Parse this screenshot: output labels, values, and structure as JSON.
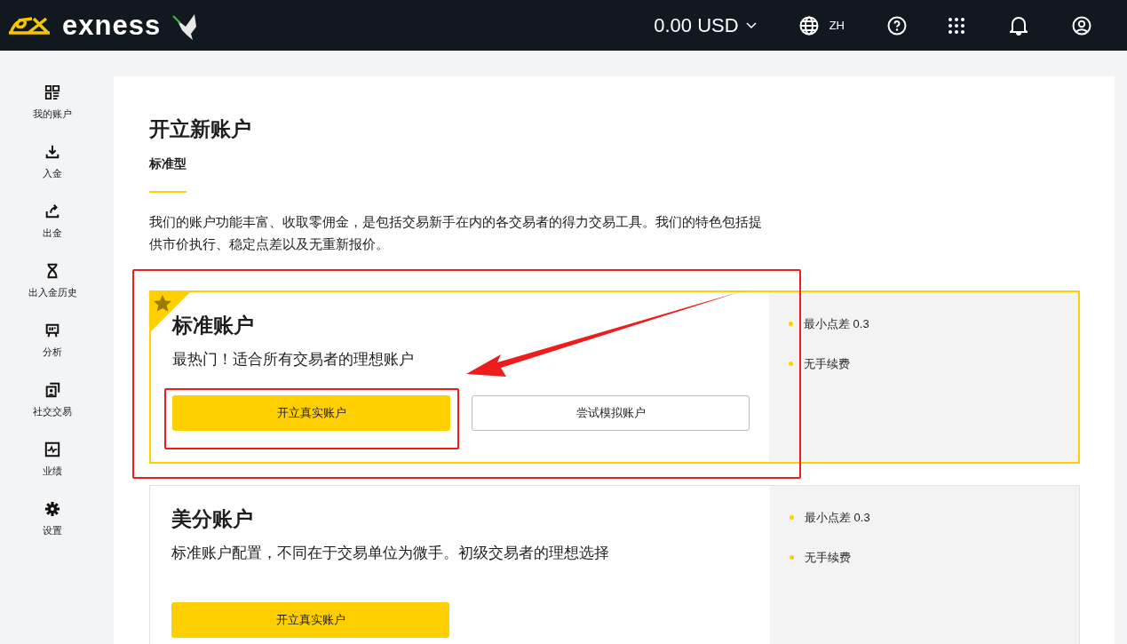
{
  "header": {
    "brand": "exness",
    "balance": "0.00 USD",
    "language": "ZH"
  },
  "sidebar": {
    "items": [
      {
        "label": "我的账户"
      },
      {
        "label": "入金"
      },
      {
        "label": "出金"
      },
      {
        "label": "出入金历史"
      },
      {
        "label": "分析"
      },
      {
        "label": "社交交易"
      },
      {
        "label": "业绩"
      },
      {
        "label": "设置"
      }
    ]
  },
  "page": {
    "title": "开立新账户",
    "tabs": [
      {
        "label": "标准型",
        "selected": true
      }
    ],
    "description": "我们的账户功能丰富、收取零佣金，是包括交易新手在内的各交易者的得力交易工具。我们的特色包括提供市价执行、稳定点差以及无重新报价。"
  },
  "accounts": [
    {
      "name": "标准账户",
      "featured": true,
      "tagline": "最热门！适合所有交易者的理想账户",
      "buttons": [
        {
          "label": "开立真实账户",
          "kind": "primary"
        },
        {
          "label": "尝试模拟账户",
          "kind": "secondary"
        }
      ],
      "features": [
        "最小点差 0.3",
        "无手续费"
      ]
    },
    {
      "name": "美分账户",
      "featured": false,
      "tagline": "标准账户配置，不同在于交易单位为微手。初级交易者的理想选择",
      "buttons": [
        {
          "label": "开立真实账户",
          "kind": "primary"
        }
      ],
      "features": [
        "最小点差 0.3",
        "无手续费"
      ]
    }
  ]
}
